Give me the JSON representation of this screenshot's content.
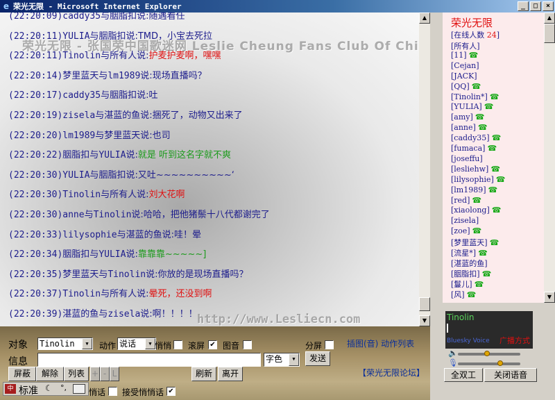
{
  "window": {
    "title": "荣光无限 - Microsoft Internet Explorer",
    "btn_min": "_",
    "btn_max": "□",
    "btn_close": "×"
  },
  "chat": {
    "bg_title": "荣光无限 - 张国荣中国歌迷网  Leslie Cheung Fans Club Of Chin",
    "bg_url": "http://www.Lesliecn.com",
    "messages": [
      {
        "ts": "(22:20:09)",
        "from": "caddy35",
        "rel": "与",
        "to": "胭脂扣",
        "say": "说:",
        "text": "随遇看任",
        "color": "blue"
      },
      {
        "ts": "(22:20:11)",
        "from": "YULIA",
        "rel": "与",
        "to": "胭脂扣",
        "say": "说:",
        "text": "TMD，小宝去死拉",
        "color": "blue"
      },
      {
        "ts": "(22:20:11)",
        "from": "Tinolin",
        "rel": "与",
        "to": "所有人",
        "say": "说:",
        "text": "护麦护麦啊，嘿嘿",
        "color": "red"
      },
      {
        "ts": "(22:20:14)",
        "from": "梦里蓝天",
        "rel": "与",
        "to": "lm1989",
        "say": "说:",
        "text": "现场直播吗？",
        "color": "blue"
      },
      {
        "ts": "(22:20:17)",
        "from": "caddy35",
        "rel": "与",
        "to": "胭脂扣",
        "say": "说:",
        "text": "吐",
        "color": "blue"
      },
      {
        "ts": "(22:20:19)",
        "from": "zisela",
        "rel": "与",
        "to": "湛蓝的鱼",
        "say": "说:",
        "text": "捆死了，动物又出来了",
        "color": "blue"
      },
      {
        "ts": "(22:20:20)",
        "from": "lm1989",
        "rel": "与",
        "to": "梦里蓝天",
        "say": "说:",
        "text": "也司",
        "color": "blue"
      },
      {
        "ts": "(22:20:22)",
        "from": "胭脂扣",
        "rel": "与",
        "to": "YULIA",
        "say": "说:",
        "text": "就是 听到这名字就不爽",
        "color": "green"
      },
      {
        "ts": "(22:20:30)",
        "from": "YULIA",
        "rel": "与",
        "to": "胭脂扣",
        "say": "说:",
        "text": "又吐~~~~~~~~~~‘",
        "color": "blue"
      },
      {
        "ts": "(22:20:30)",
        "from": "Tinolin",
        "rel": "与",
        "to": "所有人",
        "say": "说:",
        "text": "刘大花啊",
        "color": "red"
      },
      {
        "ts": "(22:20:30)",
        "from": "anne",
        "rel": "与",
        "to": "Tinolin",
        "say": "说:",
        "text": "哈哈，把他猪鬃十八代都谢完了",
        "color": "blue"
      },
      {
        "ts": "(22:20:33)",
        "from": "lilysophie",
        "rel": "与",
        "to": "湛蓝的鱼",
        "say": "说:",
        "text": "哇！晕",
        "color": "blue"
      },
      {
        "ts": "(22:20:34)",
        "from": "胭脂扣",
        "rel": "与",
        "to": "YULIA",
        "say": "说:",
        "text": "靠靠靠~~~~~]",
        "color": "green"
      },
      {
        "ts": "(22:20:35)",
        "from": "梦里蓝天",
        "rel": "与",
        "to": "Tinolin",
        "say": "说:",
        "text": "你放的是现场直播吗？",
        "color": "blue"
      },
      {
        "ts": "(22:20:37)",
        "from": "Tinolin",
        "rel": "与",
        "to": "所有人",
        "say": "说:",
        "text": "晕死，还没到啊",
        "color": "red"
      },
      {
        "ts": "(22:20:39)",
        "from": "湛蓝的鱼",
        "rel": "与",
        "to": "zisela",
        "say": "说:",
        "text": "啊！！！！",
        "color": "blue"
      }
    ]
  },
  "controls": {
    "target_label": "对象",
    "target_value": "Tinolin",
    "action_label": "动作",
    "action_value": "说话",
    "whisper_label": "悄悄",
    "scroll_label": "滚屏",
    "image_label": "图音",
    "split_label": "分屏",
    "media_links": "插图(音) 动作列表",
    "message_label": "信息",
    "color_label": "字色",
    "send_button": "发送",
    "block_button": "屏蔽",
    "unblock_button": "解除",
    "list_button": "列表",
    "refresh_button": "刷新",
    "leave_button": "离开",
    "forum_link": "【荣光无限论坛】",
    "ime_label": "标准",
    "bottom_whisper": "悄话",
    "accept_whisper": "接受悄悄话",
    "plus_btn": "+",
    "minus_btn": "-",
    "l_btn": "L"
  },
  "users": {
    "room_name": "荣光无限",
    "online_label": "[在线人数",
    "online_count": "24",
    "online_close": "]",
    "list": [
      {
        "name": "[所有人]",
        "phone": false
      },
      {
        "name": "[11]",
        "phone": true
      },
      {
        "name": "[Cejan]",
        "phone": false
      },
      {
        "name": "[JACK]",
        "phone": false
      },
      {
        "name": "[QQ]",
        "phone": true
      },
      {
        "name": "[Tinolin*]",
        "phone": true
      },
      {
        "name": "[YULIA]",
        "phone": true
      },
      {
        "name": "[amy]",
        "phone": true
      },
      {
        "name": "[anne]",
        "phone": true
      },
      {
        "name": "[caddy35]",
        "phone": true
      },
      {
        "name": "[fumaca]",
        "phone": true
      },
      {
        "name": "[joseffu]",
        "phone": false
      },
      {
        "name": "[lesliehw]",
        "phone": true
      },
      {
        "name": "[lilysophie]",
        "phone": true
      },
      {
        "name": "[lm1989]",
        "phone": true
      },
      {
        "name": "[red]",
        "phone": true
      },
      {
        "name": "[xiaolong]",
        "phone": true
      },
      {
        "name": "[zisela]",
        "phone": false
      },
      {
        "name": "[zoe]",
        "phone": true
      },
      {
        "name": "[梦里蓝天]",
        "phone": true
      },
      {
        "name": "[流星*]",
        "phone": true
      },
      {
        "name": "[湛蓝的鱼]",
        "phone": false
      },
      {
        "name": "[胭脂扣]",
        "phone": true
      },
      {
        "name": "[鬘儿]",
        "phone": true
      },
      {
        "name": "[风]",
        "phone": true
      }
    ],
    "phone_icon": "☎"
  },
  "voice": {
    "speaker": "Tinolin",
    "brand": "Bluesky Voice",
    "mode": "广播方式",
    "volume_level_pct": 46,
    "mic_level_pct": 70,
    "duplex_button": "全双工",
    "close_voice_button": "关闭语音"
  },
  "colors": {
    "red": "#e01010",
    "green": "#1b9a1b",
    "blue": "#1c1c8c"
  }
}
